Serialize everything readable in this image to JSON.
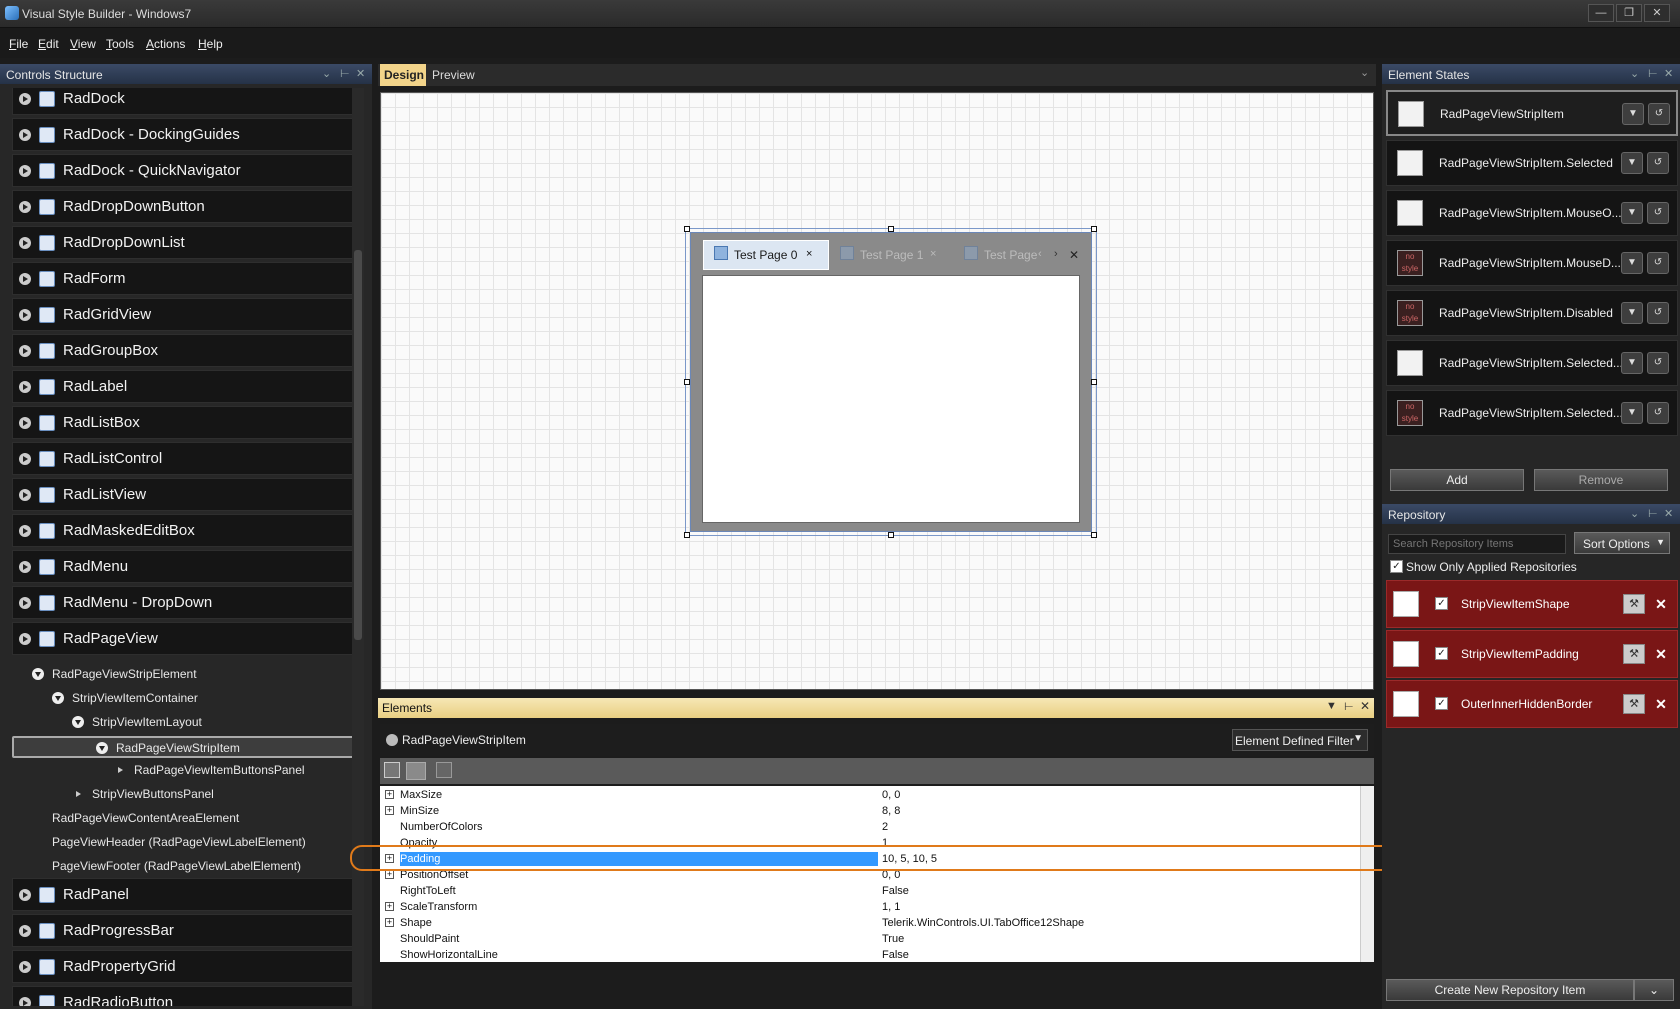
{
  "window": {
    "title": "Visual Style Builder - Windows7",
    "controls": [
      "minimize",
      "restore",
      "close"
    ]
  },
  "menu": [
    "File",
    "Edit",
    "View",
    "Tools",
    "Actions",
    "Help"
  ],
  "left_panel": {
    "title": "Controls Structure",
    "tree_items": [
      "RadDock",
      "RadDock - DockingGuides",
      "RadDock - QuickNavigator",
      "RadDropDownButton",
      "RadDropDownList",
      "RadForm",
      "RadGridView",
      "RadGroupBox",
      "RadLabel",
      "RadListBox",
      "RadListControl",
      "RadListView",
      "RadMaskedEditBox",
      "RadMenu",
      "RadMenu - DropDown",
      "RadPageView"
    ],
    "sub_items": [
      "RadPageViewStripElement",
      "StripViewItemContainer",
      "StripViewItemLayout",
      "RadPageViewStripItem",
      "RadPageViewItemButtonsPanel",
      "StripViewButtonsPanel",
      "RadPageViewContentAreaElement",
      "PageViewHeader (RadPageViewLabelElement)",
      "PageViewFooter (RadPageViewLabelElement)"
    ],
    "tree_items_after": [
      "RadPanel",
      "RadProgressBar",
      "RadPropertyGrid",
      "RadRadioButton"
    ]
  },
  "center": {
    "tabs": {
      "design": "Design",
      "preview": "Preview"
    },
    "page_view": {
      "tab0": "Test Page 0",
      "tab1": "Test Page 1",
      "tab2": "Test Page",
      "close_glyph": "×"
    }
  },
  "elements": {
    "title": "Elements",
    "selected_element": "RadPageViewStripItem",
    "filter": "Element Defined Filter",
    "properties": [
      {
        "name": "MaxSize",
        "value": "0, 0",
        "expandable": true
      },
      {
        "name": "MinSize",
        "value": "8, 8",
        "expandable": true
      },
      {
        "name": "NumberOfColors",
        "value": "2",
        "expandable": false
      },
      {
        "name": "Opacity",
        "value": "1",
        "expandable": false
      },
      {
        "name": "Padding",
        "value": "10, 5, 10, 5",
        "expandable": true,
        "selected": true
      },
      {
        "name": "PositionOffset",
        "value": "0, 0",
        "expandable": true
      },
      {
        "name": "RightToLeft",
        "value": "False",
        "expandable": false
      },
      {
        "name": "ScaleTransform",
        "value": "1, 1",
        "expandable": true
      },
      {
        "name": "Shape",
        "value": "Telerik.WinControls.UI.TabOffice12Shape",
        "expandable": true
      },
      {
        "name": "ShouldPaint",
        "value": "True",
        "expandable": false
      },
      {
        "name": "ShowHorizontalLine",
        "value": "False",
        "expandable": false
      }
    ]
  },
  "element_states": {
    "title": "Element States",
    "states": [
      {
        "label": "RadPageViewStripItem",
        "nostyle": false
      },
      {
        "label": "RadPageViewStripItem.Selected",
        "nostyle": false
      },
      {
        "label": "RadPageViewStripItem.MouseO...",
        "nostyle": false
      },
      {
        "label": "RadPageViewStripItem.MouseD...",
        "nostyle": true
      },
      {
        "label": "RadPageViewStripItem.Disabled",
        "nostyle": true
      },
      {
        "label": "RadPageViewStripItem.Selected...",
        "nostyle": false
      },
      {
        "label": "RadPageViewStripItem.Selected...",
        "nostyle": true
      }
    ],
    "nostyle_text": "no style",
    "add": "Add",
    "remove": "Remove"
  },
  "repository": {
    "title": "Repository",
    "search_placeholder": "Search Repository Items",
    "sort": "Sort Options",
    "show_only_applied": "Show Only Applied Repositories",
    "items": [
      "StripViewItemShape",
      "StripViewItemPadding",
      "OuterInnerHiddenBorder"
    ],
    "create": "Create New Repository Item"
  },
  "colors": {
    "accent": "#3399ff",
    "highlight_ring": "#e07a1a",
    "repo_row": "#7a1616",
    "design_tab": "#f2d48a"
  }
}
